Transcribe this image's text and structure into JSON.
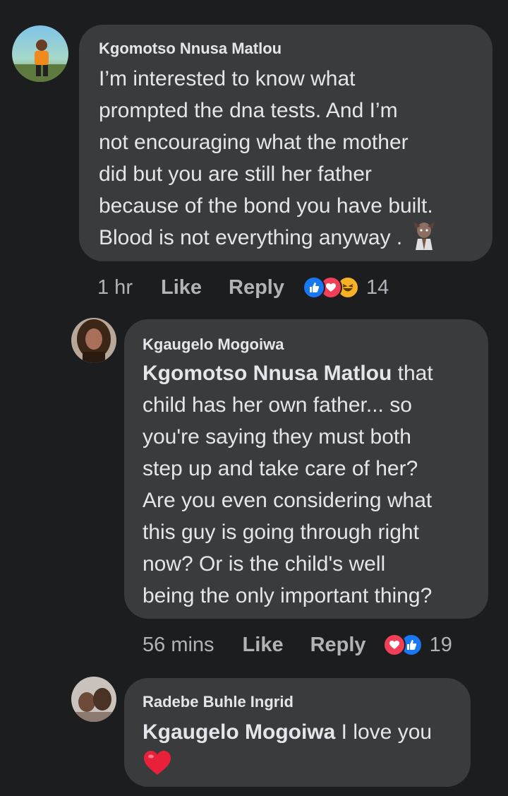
{
  "comments": [
    {
      "author": "Kgomotso Nnusa Matlou",
      "text": "I’m interested to know what\nprompted the dna tests. And I’m\nnot encouraging what the mother\ndid but you are still her father\nbecause of the bond you have built.\nBlood is not everything anyway .",
      "emoji": "zombie-woman-emoji",
      "time": "1 hr",
      "like_label": "Like",
      "reply_label": "Reply",
      "reactions": [
        "like-icon",
        "love-icon",
        "haha-icon"
      ],
      "reaction_count": "14"
    },
    {
      "author": "Kgaugelo Mogoiwa",
      "mention": "Kgomotso Nnusa Matlou",
      "text": " that\nchild has her own father... so\nyou're saying they must both\nstep up and take care of her?\nAre you even considering what\nthis guy is going through right\nnow? Or is the child's well\nbeing the only important thing?",
      "time": "56 mins",
      "like_label": "Like",
      "reply_label": "Reply",
      "reactions": [
        "love-icon",
        "like-icon"
      ],
      "reaction_count": "19"
    },
    {
      "author": "Radebe Buhle Ingrid",
      "mention": "Kgaugelo Mogoiwa",
      "text": " I love you",
      "emoji": "red-heart-emoji"
    }
  ],
  "colors": {
    "background": "#1c1d1f",
    "bubble": "#3a3b3c",
    "text": "#e4e6eb",
    "secondary": "#b0b3b8",
    "like_blue": "#1877f2",
    "love_red": "#f33e58",
    "haha_yellow": "#f7b125"
  }
}
